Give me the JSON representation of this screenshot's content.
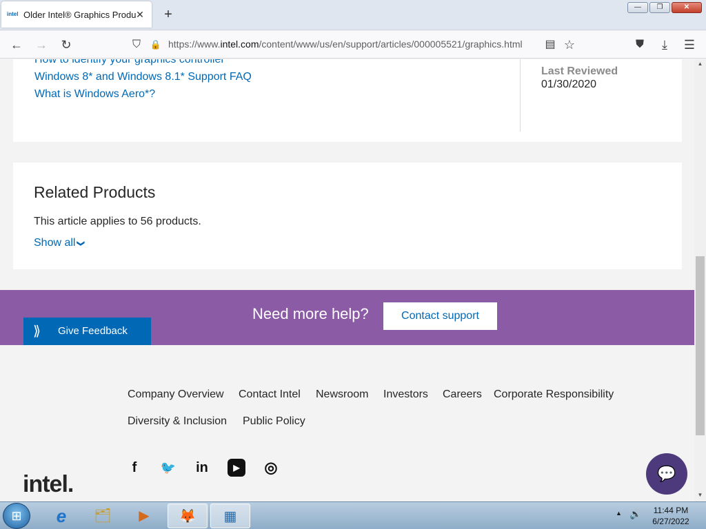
{
  "browser": {
    "tab": {
      "favicon_text": "intel",
      "title": "Older Intel® Graphics Products",
      "close": "✕"
    },
    "new_tab": "+",
    "window_buttons": {
      "minimize": "—",
      "maximize": "❐",
      "close": "✕"
    },
    "nav": {
      "back": "←",
      "forward": "→",
      "reload": "↻",
      "shield": "⛉",
      "lock": "🔒",
      "reader": "▤",
      "bookmark": "☆",
      "pocket": "⛊",
      "downloads": "⤓",
      "menu": "☰"
    },
    "url": {
      "prefix": "https://www.",
      "domain": "intel.com",
      "path": "/content/www/us/en/support/articles/000005521/graphics.html"
    }
  },
  "article": {
    "links": [
      "How to identify your graphics controller",
      "Windows 8* and Windows 8.1* Support FAQ",
      "What is Windows Aero*?"
    ],
    "meta_id": "000005521",
    "last_reviewed_label": "Last Reviewed",
    "last_reviewed_value": "01/30/2020"
  },
  "related": {
    "title": "Related Products",
    "text": "This article applies to 56 products.",
    "show_all": "Show all",
    "show_all_icon": "❯"
  },
  "help": {
    "text": "Need more help?",
    "contact_button": "Contact support",
    "feedback_label": "Give Feedback",
    "feedback_icon": "⟫"
  },
  "footer": {
    "links": [
      "Company Overview",
      "Contact Intel",
      "Newsroom",
      "Investors",
      "Careers",
      "Corporate Responsibility",
      "Diversity & Inclusion",
      "Public Policy"
    ],
    "social": {
      "facebook": "f",
      "twitter": "🐦",
      "linkedin": "in",
      "youtube": "▶",
      "instagram": "◎"
    },
    "logo": "intel.",
    "chat_icon": "💬"
  },
  "taskbar": {
    "start_icon": "⊞",
    "tasks": [
      {
        "name": "internet-explorer-icon",
        "glyph": "e"
      },
      {
        "name": "file-explorer-icon",
        "glyph": "🗂"
      },
      {
        "name": "media-player-icon",
        "glyph": "▶"
      },
      {
        "name": "firefox-icon",
        "glyph": "🦊"
      },
      {
        "name": "control-panel-icon",
        "glyph": "▦"
      }
    ],
    "tray": {
      "up_arrow": "▲",
      "volume": "🔊"
    },
    "time": "11:44 PM",
    "date": "6/27/2022"
  }
}
